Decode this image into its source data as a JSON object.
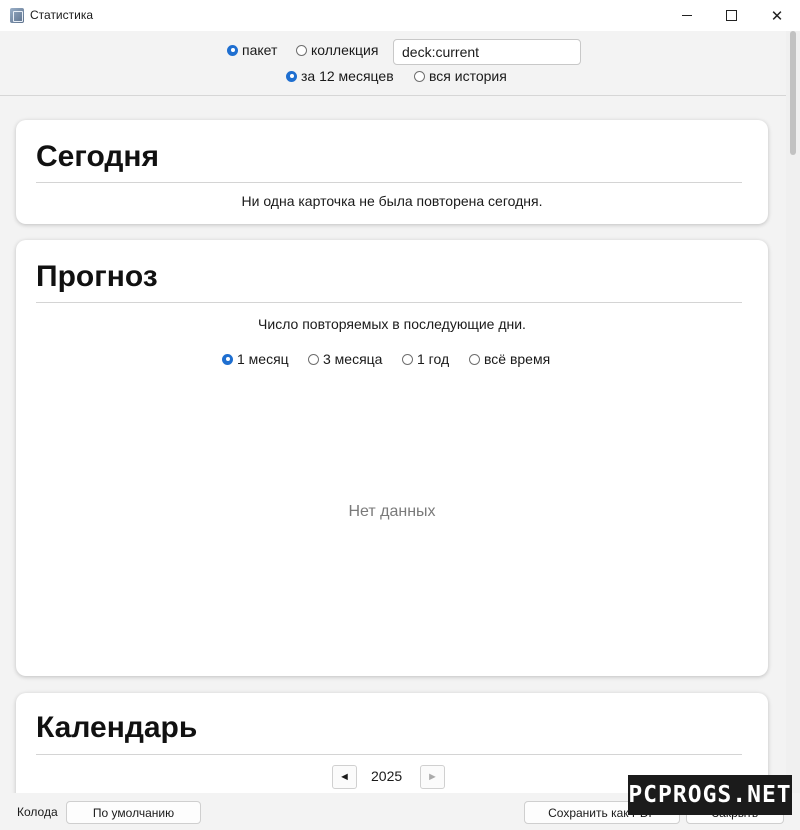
{
  "window": {
    "title": "Статистика"
  },
  "filter": {
    "scope_deck": "пакет",
    "scope_collection": "коллекция",
    "search_value": "deck:current",
    "period_year": "за 12 месяцев",
    "period_all": "вся история"
  },
  "today": {
    "title": "Сегодня",
    "message": "Ни одна карточка не была повторена сегодня."
  },
  "forecast": {
    "title": "Прогноз",
    "description": "Число повторяемых в последующие дни.",
    "ranges": [
      "1 месяц",
      "3 месяца",
      "1 год",
      "всё время"
    ],
    "selected_range": "1 месяц",
    "no_data": "Нет данных"
  },
  "calendar": {
    "title": "Календарь",
    "year": "2025",
    "prev_glyph": "◄",
    "next_glyph": "►"
  },
  "bottom": {
    "deck_label": "Колода",
    "preset_button": "По умолчанию",
    "save_pdf_button": "Сохранить как PDF",
    "close_button": "Закрыть"
  },
  "watermark": "PCPROGS.NET",
  "colors": {
    "accent": "#1f6fd0",
    "background": "#f3f3f3",
    "card": "#ffffff"
  }
}
